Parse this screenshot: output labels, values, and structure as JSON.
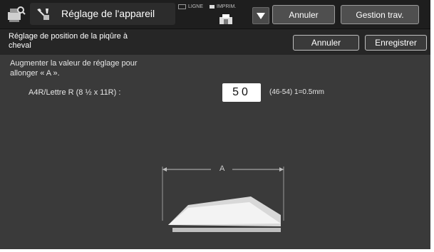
{
  "header": {
    "title": "Réglage de l'appareil",
    "status_line": "LIGNE",
    "status_print": "IMPRIM.",
    "cancel_label": "Annuler",
    "job_status_label": "Gestion trav."
  },
  "subheader": {
    "title": "Réglage de position de la piqûre à cheval",
    "cancel_label": "Annuler",
    "save_label": "Enregistrer"
  },
  "content": {
    "instruction": "Augmenter la valeur de réglage pour allonger « A ».",
    "paper_label": "A4R/Lettre R (8 ½ x 11R) :",
    "value": "50",
    "range": "(46-54) 1=0.5mm",
    "dimension_label": "A"
  },
  "icons": {
    "app": "copier-settings-icon",
    "title": "tools-icon",
    "printer": "printer-icon",
    "dropdown": "triangle-down-icon"
  },
  "colors": {
    "background": "#3a3a3a",
    "header": "#1e1e1e",
    "subheader": "#262626",
    "text": "#ffffff",
    "value_box": "#ffffff"
  }
}
